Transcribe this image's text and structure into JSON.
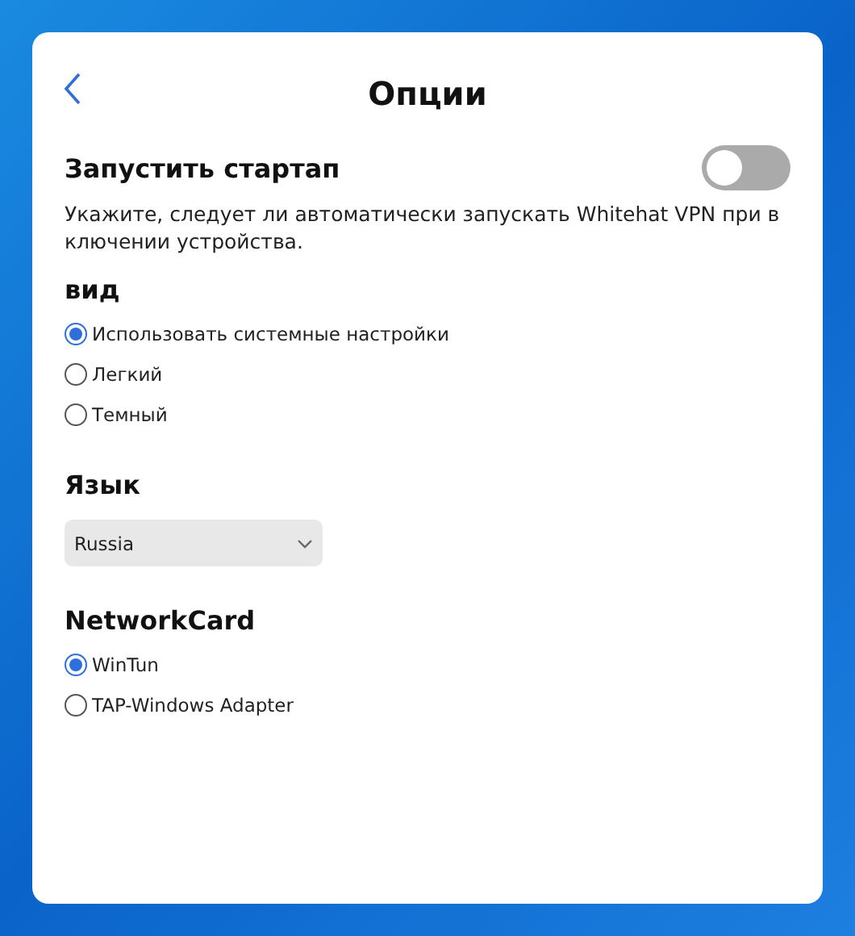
{
  "window": {
    "title": "Опции"
  },
  "startup": {
    "title": "Запустить стартап",
    "on": false,
    "description": "Укажите, следует ли автоматически запускать Whitehat VPN при включении устройства."
  },
  "theme": {
    "title": "вид",
    "options": [
      {
        "label": "Использовать системные настройки",
        "selected": true
      },
      {
        "label": "Легкий",
        "selected": false
      },
      {
        "label": "Темный",
        "selected": false
      }
    ]
  },
  "language": {
    "title": "Язык",
    "value": "Russia"
  },
  "network_card": {
    "title": "NetworkCard",
    "options": [
      {
        "label": "WinTun",
        "selected": true
      },
      {
        "label": "TAP-Windows Adapter",
        "selected": false
      }
    ]
  }
}
